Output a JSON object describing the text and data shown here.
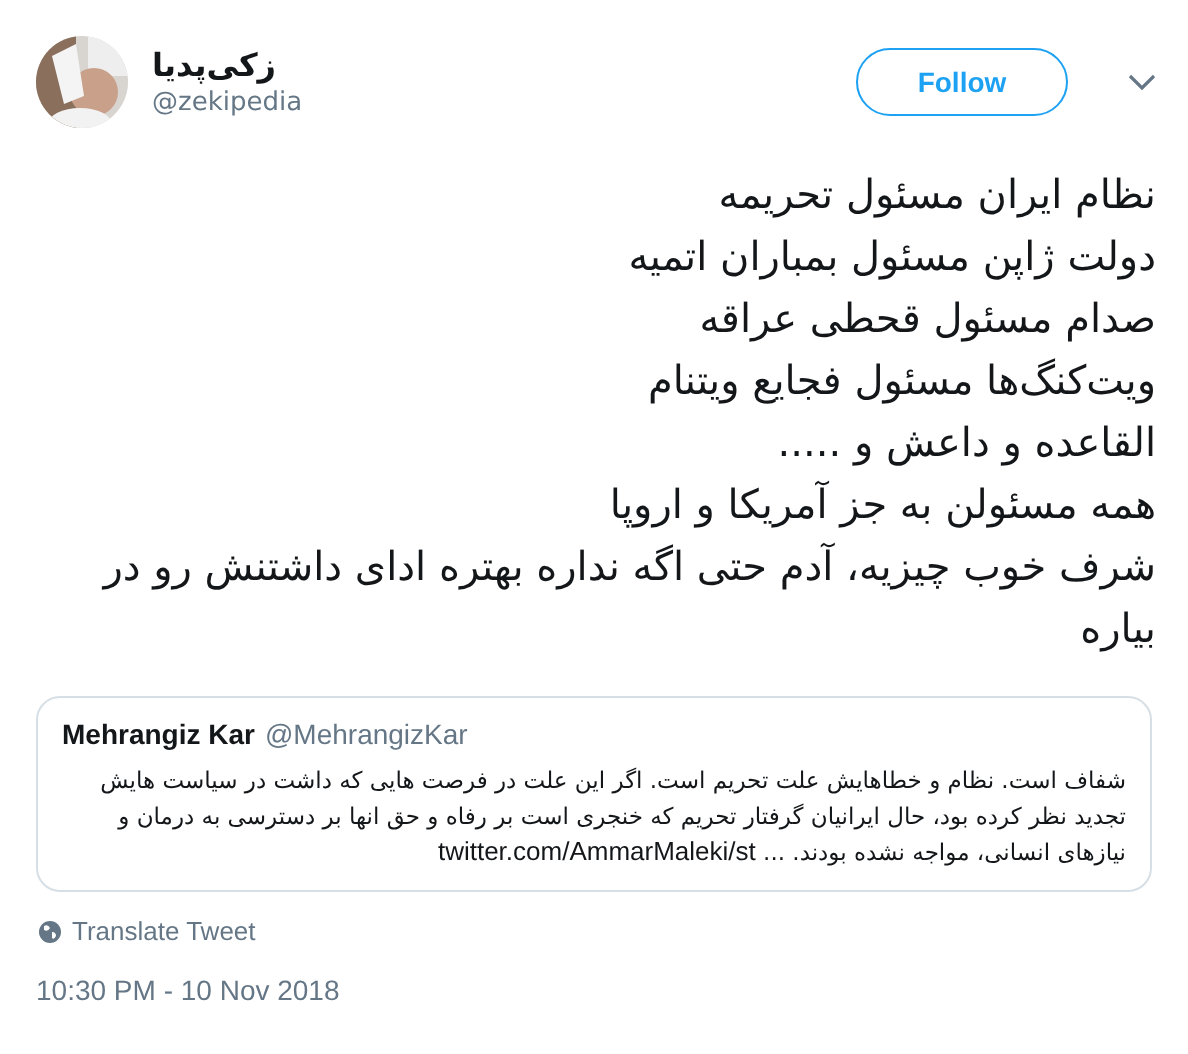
{
  "author": {
    "name": "زکی‌پدیا",
    "handle": "@zekipedia"
  },
  "follow_button": {
    "label": "Follow"
  },
  "tweet_lines": [
    "نظام ایران مسئول تحریمه",
    "دولت ژاپن مسئول بمباران اتمیه",
    "صدام مسئول قحطی عراقه",
    "ویت‌کنگ‌ها مسئول فجایع ویتنام",
    "القاعده و داعش و .....",
    "همه مسئولن به جز آمریکا و اروپا",
    "شرف خوب چیزیه، آدم حتی اگه نداره بهتره ادای داشتنش رو در بیاره"
  ],
  "quoted_tweet": {
    "name": "Mehrangiz Kar",
    "handle": "@MehrangizKar",
    "text": "شفاف است. نظام و خطاهایش علت تحریم است. اگر این علت در فرصت هایی که داشت در سیاست هایش تجدید نظر کرده بود، حال ایرانیان گرفتار تحریم که خنجری است بر رفاه و حق انها بر دسترسی به درمان و نیازهای انسانی، مواجه نشده بودند. ...",
    "link": "twitter.com/AmmarMaleki/st"
  },
  "translate_link": "Translate Tweet",
  "timestamp": "10:30 PM - 10 Nov 2018"
}
